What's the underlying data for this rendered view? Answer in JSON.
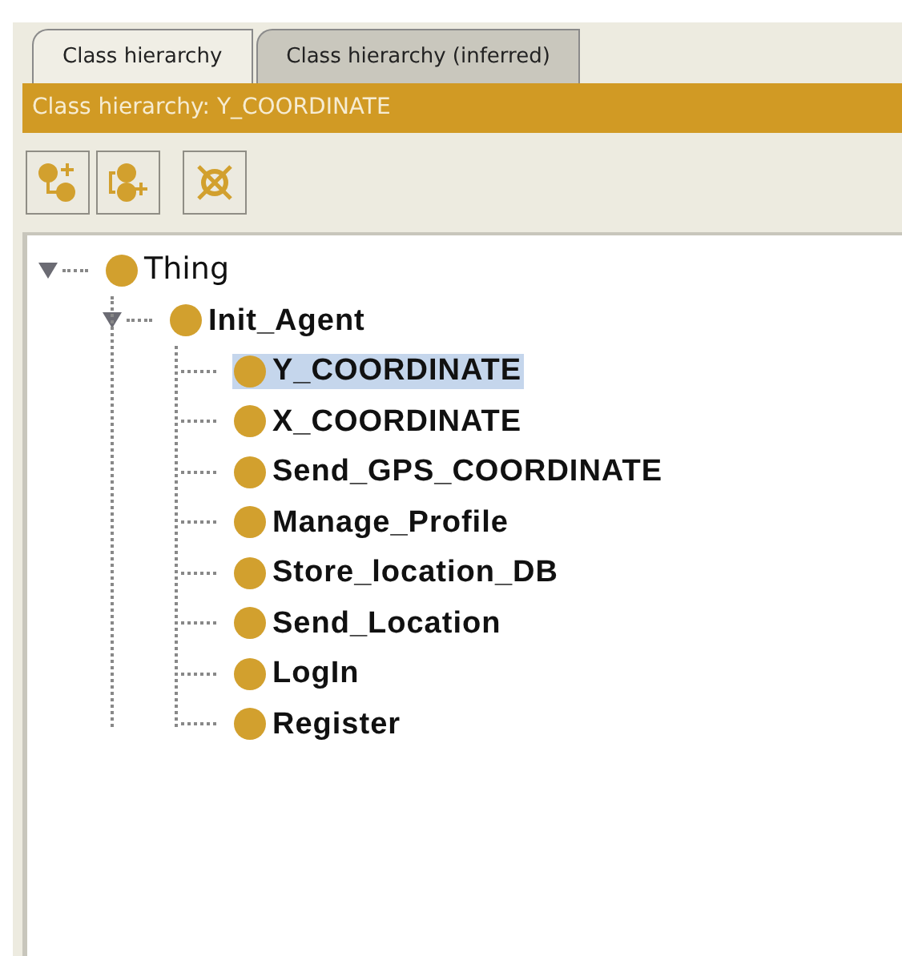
{
  "tabs": [
    {
      "label": "Class hierarchy",
      "selected": true
    },
    {
      "label": "Class hierarchy (inferred)",
      "selected": false
    }
  ],
  "header": {
    "title": "Class hierarchy: Y_COORDINATE"
  },
  "tree": [
    {
      "label": "Thing",
      "bold": false,
      "selected": false,
      "expanded": true,
      "children": [
        {
          "label": "Init_Agent",
          "bold": true,
          "selected": false,
          "expanded": true,
          "children": [
            {
              "label": "Y_COORDINATE",
              "bold": true,
              "selected": true
            },
            {
              "label": "X_COORDINATE",
              "bold": true,
              "selected": false
            },
            {
              "label": "Send_GPS_COORDINATE",
              "bold": true,
              "selected": false
            },
            {
              "label": "Manage_Profile",
              "bold": true,
              "selected": false
            },
            {
              "label": "Store_location_DB",
              "bold": true,
              "selected": false
            },
            {
              "label": "Send_Location",
              "bold": true,
              "selected": false
            },
            {
              "label": "LogIn",
              "bold": true,
              "selected": false
            },
            {
              "label": "Register",
              "bold": true,
              "selected": false
            }
          ]
        }
      ]
    }
  ]
}
